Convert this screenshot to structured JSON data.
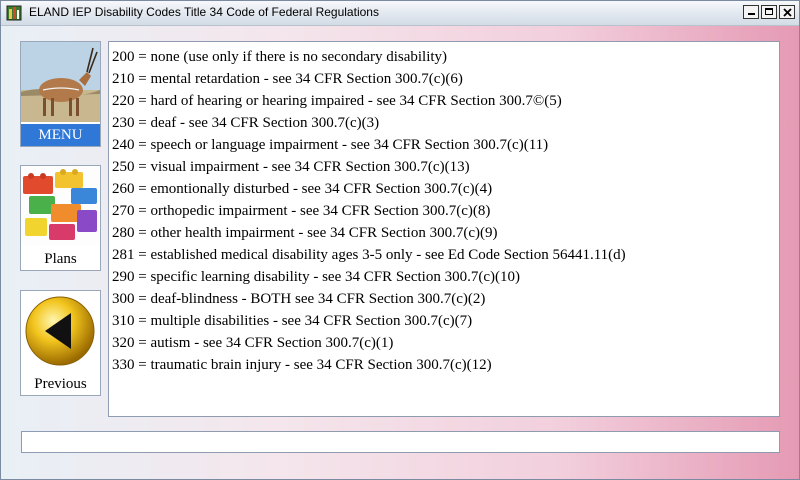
{
  "window": {
    "title": "ELAND IEP Disability Codes Title 34 Code of Federal Regulations"
  },
  "nav": {
    "menu_label": "MENU",
    "plans_label": "Plans",
    "previous_label": "Previous"
  },
  "codes": [
    "200 = none (use only if there is no secondary disability)",
    "210 = mental retardation - see 34 CFR Section 300.7(c)(6)",
    "220 = hard of hearing or hearing impaired - see 34 CFR Section 300.7©(5)",
    "230 = deaf - see 34 CFR Section 300.7(c)(3)",
    "240 = speech or language impairment - see 34 CFR Section 300.7(c)(11)",
    "250 = visual impairment - see 34 CFR Section 300.7(c)(13)",
    "260 = emontionally disturbed - see 34 CFR Section 300.7(c)(4)",
    "270 = orthopedic impairment - see 34 CFR Section 300.7(c)(8)",
    "280 = other health impairment - see 34 CFR Section 300.7(c)(9)",
    "281 = established medical disability ages 3-5 only - see Ed Code Section 56441.11(d)",
    "290 = specific learning disability - see 34 CFR Section 300.7(c)(10)",
    "300 = deaf-blindness - BOTH see 34 CFR Section 300.7(c)(2)",
    "310 = multiple disabilities - see 34 CFR Section 300.7(c)(7)",
    "320 = autism - see 34 CFR Section 300.7(c)(1)",
    "330 = traumatic brain injury - see 34 CFR Section 300.7(c)(12)"
  ],
  "status": {
    "text": ""
  }
}
